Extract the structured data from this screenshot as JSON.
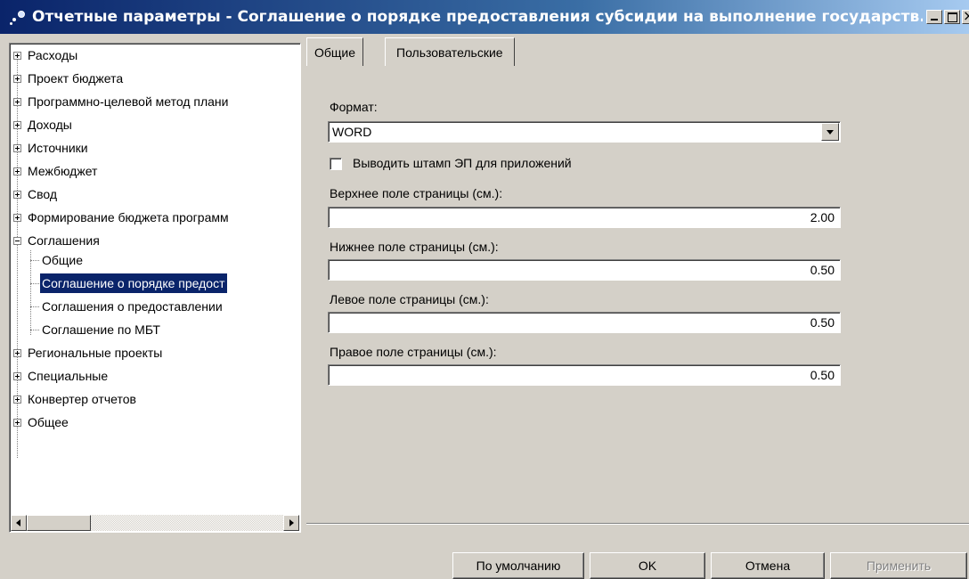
{
  "window": {
    "title": "Отчетные параметры - Соглашение о порядке предоставления субсидии на выполнение государств..."
  },
  "tree": {
    "items": [
      {
        "label": "Расходы",
        "expander": "+"
      },
      {
        "label": "Проект бюджета",
        "expander": "+"
      },
      {
        "label": "Программно-целевой метод плани",
        "expander": "+"
      },
      {
        "label": "Доходы",
        "expander": "+"
      },
      {
        "label": "Источники",
        "expander": "+"
      },
      {
        "label": "Межбюджет",
        "expander": "+"
      },
      {
        "label": "Свод",
        "expander": "+"
      },
      {
        "label": "Формирование бюджета программ",
        "expander": "+"
      },
      {
        "label": "Соглашения",
        "expander": "-"
      },
      {
        "label": "Общие",
        "child": true
      },
      {
        "label": "Соглашение о порядке предост",
        "child": true,
        "selected": true
      },
      {
        "label": "Соглашения о предоставлении",
        "child": true
      },
      {
        "label": "Соглашение по МБТ",
        "child": true
      },
      {
        "label": "Региональные проекты",
        "expander": "+"
      },
      {
        "label": "Специальные",
        "expander": "+"
      },
      {
        "label": "Конвертер отчетов",
        "expander": "+"
      },
      {
        "label": "Общее",
        "expander": "+"
      }
    ]
  },
  "tabs": [
    {
      "label": "Общие",
      "active": true
    },
    {
      "label": "Пользовательские",
      "active": false
    }
  ],
  "form": {
    "format_label": "Формат:",
    "format_value": "WORD",
    "stamp_label": "Выводить штамп ЭП для приложений",
    "stamp_checked": false,
    "top_margin_label": "Верхнее поле страницы (см.):",
    "top_margin_value": "2.00",
    "bottom_margin_label": "Нижнее поле страницы (см.):",
    "bottom_margin_value": "0.50",
    "left_margin_label": "Левое поле страницы (см.):",
    "left_margin_value": "0.50",
    "right_margin_label": "Правое поле страницы (см.):",
    "right_margin_value": "0.50"
  },
  "buttons": {
    "default_label": "По умолчанию",
    "ok_label": "OK",
    "cancel_label": "Отмена",
    "apply_label": "Применить"
  },
  "colors": {
    "titlebar_start": "#0a246a",
    "titlebar_end": "#a6caf0",
    "selection": "#0a246a",
    "face": "#d4d0c8"
  }
}
